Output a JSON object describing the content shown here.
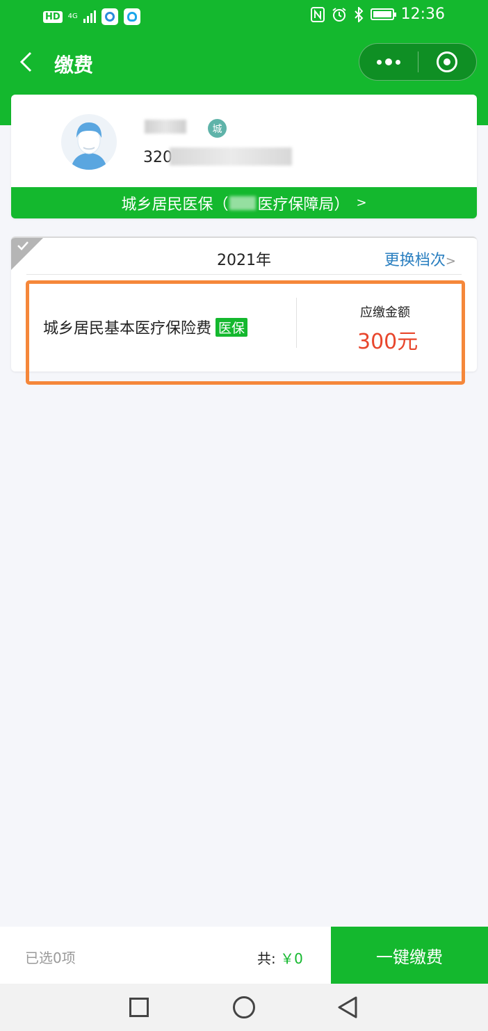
{
  "status_bar": {
    "time": "12:36",
    "network": "4G",
    "hd": "HD"
  },
  "header": {
    "title": "缴费"
  },
  "profile": {
    "name": "",
    "badge": "城",
    "id_prefix": "320",
    "insurance_text_prefix": "城乡居民医保（",
    "insurance_text_suffix": "医疗保障局）",
    "insurance_chevron": ">"
  },
  "year_card": {
    "year": "2021年",
    "change_label": "更换档次",
    "change_chevron": ">",
    "item_name": "城乡居民基本医疗保险费",
    "item_tag": "医保",
    "due_label": "应缴金额",
    "due_amount": "300元"
  },
  "bottom_bar": {
    "selected_text": "已选0项",
    "total_label": "共:",
    "total_amount": "￥0",
    "pay_button": "一键缴费"
  },
  "colors": {
    "primary": "#14b82e",
    "amount": "#e8462c",
    "link": "#2a7fc0",
    "highlight": "#f5873a"
  }
}
